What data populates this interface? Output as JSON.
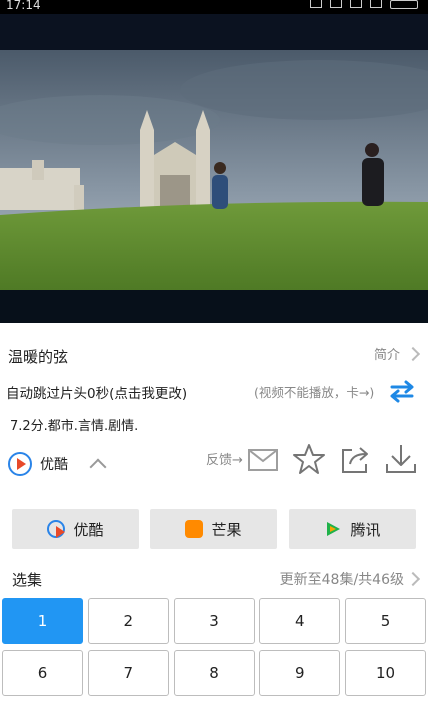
{
  "status_bar": {
    "time": "17:14"
  },
  "show": {
    "title": "温暖的弦",
    "intro_label": "简介",
    "skip_intro_text": "自动跳过片头0秒(点击我更改)",
    "cant_play_text": "(视频不能播放，卡→)",
    "meta": "7.2分.都市.言情.剧情.",
    "current_source": "优酷",
    "feedback_label": "反馈→"
  },
  "sources": [
    {
      "label": "优酷",
      "icon": "youku-icon"
    },
    {
      "label": "芒果",
      "icon": "mango-icon"
    },
    {
      "label": "腾讯",
      "icon": "tencent-icon"
    }
  ],
  "episodes": {
    "heading": "选集",
    "update_text": "更新至48集/共46级",
    "selected": "1",
    "items": [
      "1",
      "2",
      "3",
      "4",
      "5",
      "6",
      "7",
      "8",
      "9",
      "10"
    ]
  },
  "colors": {
    "accent": "#2196f3",
    "source_bg": "#e6e6e6"
  }
}
